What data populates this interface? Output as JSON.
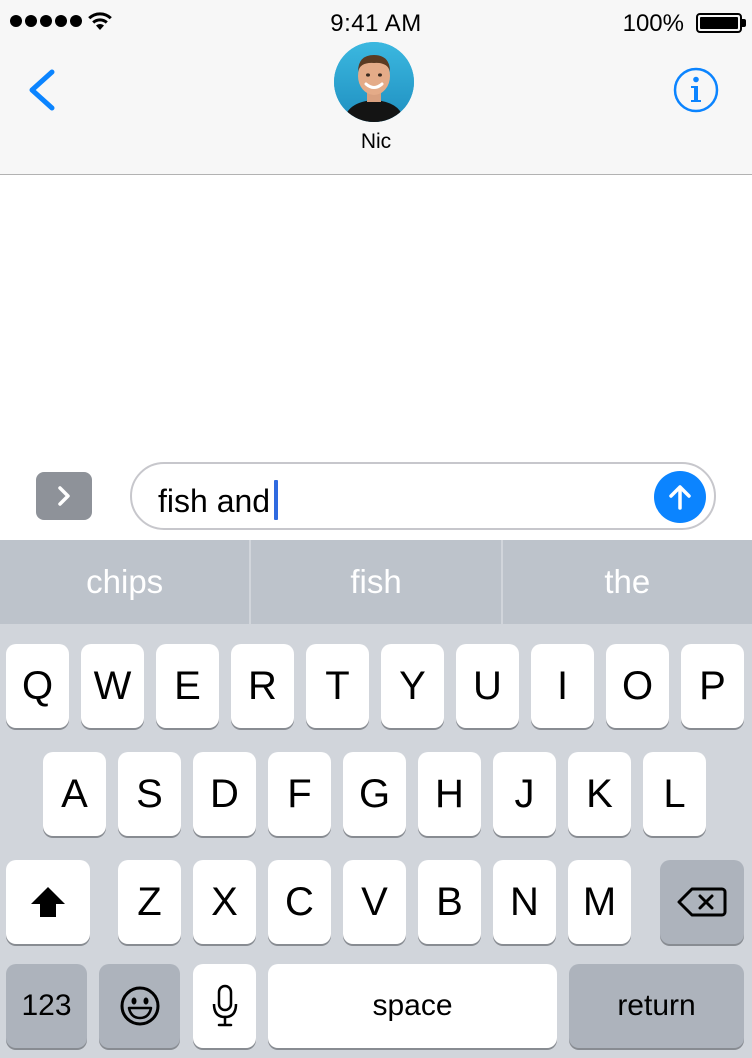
{
  "status_bar": {
    "time": "9:41 AM",
    "battery_percent": "100%",
    "signal_bars": 5,
    "icons": [
      "signal-dots-icon",
      "wifi-icon",
      "battery-icon"
    ]
  },
  "header": {
    "contact_name": "Nic",
    "back_icon": "chevron-left-icon",
    "info_icon": "info-icon",
    "accent_color": "#0b84ff"
  },
  "compose": {
    "apps_icon": "chevron-right-icon",
    "message_text": "fish and",
    "send_icon": "arrow-up-icon",
    "send_color": "#0b84ff"
  },
  "keyboard": {
    "suggestions": [
      "chips",
      "fish",
      "the"
    ],
    "row1": [
      "Q",
      "W",
      "E",
      "R",
      "T",
      "Y",
      "U",
      "I",
      "O",
      "P"
    ],
    "row2": [
      "A",
      "S",
      "D",
      "F",
      "G",
      "H",
      "J",
      "K",
      "L"
    ],
    "row3": [
      "Z",
      "X",
      "C",
      "V",
      "B",
      "N",
      "M"
    ],
    "numbers_label": "123",
    "space_label": "space",
    "return_label": "return",
    "shift_icon": "shift-arrow-icon",
    "delete_icon": "backspace-icon",
    "emoji_icon": "emoji-smile-icon",
    "mic_icon": "microphone-icon"
  }
}
